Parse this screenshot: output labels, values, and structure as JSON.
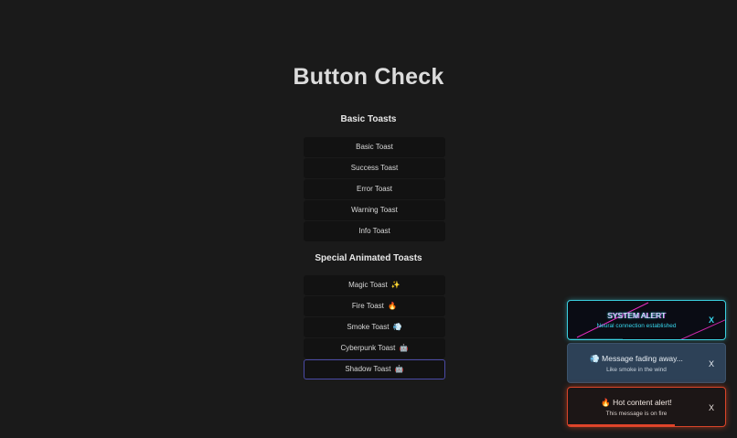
{
  "page": {
    "title": "Button Check"
  },
  "sections": {
    "basic": {
      "title": "Basic Toasts",
      "buttons": [
        "Basic Toast",
        "Success Toast",
        "Error Toast",
        "Warning Toast",
        "Info Toast"
      ]
    },
    "special": {
      "title": "Special Animated Toasts",
      "buttons": [
        {
          "label": "Magic Toast",
          "emoji": "✨"
        },
        {
          "label": "Fire Toast",
          "emoji": "🔥"
        },
        {
          "label": "Smoke Toast",
          "emoji": "💨"
        },
        {
          "label": "Cyberpunk Toast",
          "emoji": "🤖"
        },
        {
          "label": "Shadow Toast",
          "emoji": "🤖"
        }
      ]
    }
  },
  "toasts": [
    {
      "title": "SYSTEM ALERT",
      "message": "Neural connection established",
      "close": "X",
      "accent": "#37d7ee"
    },
    {
      "emoji": "💨",
      "title": "Message fading away...",
      "message": "Like smoke in the wind",
      "close": "X",
      "progress": 0.0
    },
    {
      "emoji": "🔥",
      "title": "Hot content alert!",
      "message": "This message is on fire",
      "close": "X",
      "progress": 0.68,
      "accent": "#e0442a"
    }
  ]
}
